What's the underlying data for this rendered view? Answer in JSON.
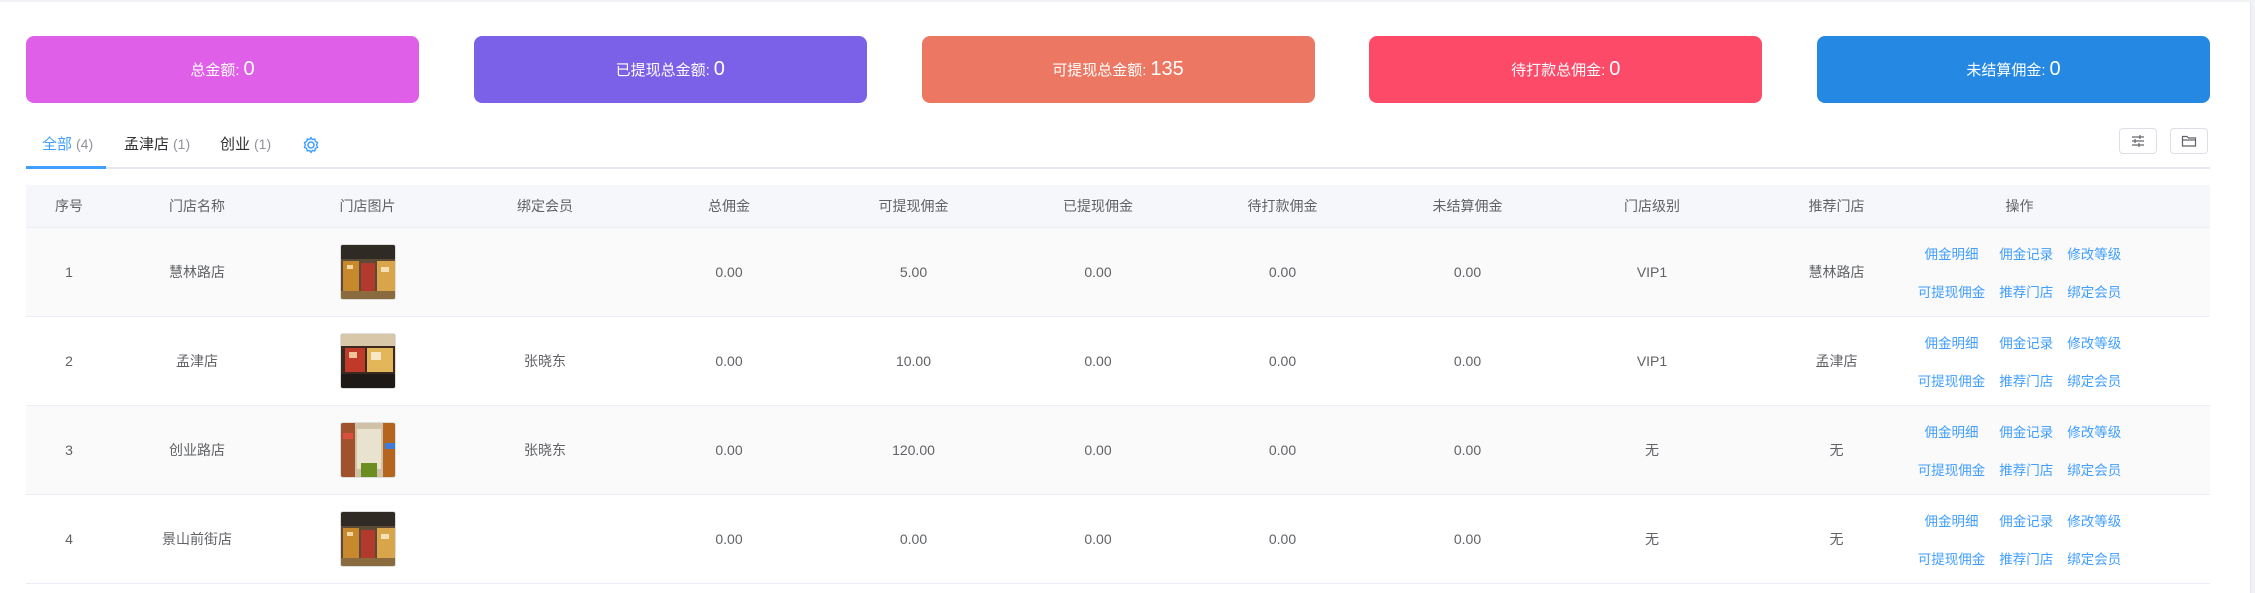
{
  "summary_cards": [
    {
      "label": "总金额:",
      "value": "0",
      "color": "#e05fe8"
    },
    {
      "label": "已提现总金额:",
      "value": "0",
      "color": "#7b61e8"
    },
    {
      "label": "可提现总金额:",
      "value": "135",
      "color": "#ec7762"
    },
    {
      "label": "待打款总佣金:",
      "value": "0",
      "color": "#fe4a69"
    },
    {
      "label": "未结算佣金:",
      "value": "0",
      "color": "#2589e3"
    }
  ],
  "tabs": [
    {
      "label": "全部",
      "count": "(4)"
    },
    {
      "label": "孟津店",
      "count": "(1)"
    },
    {
      "label": "创业",
      "count": "(1)"
    }
  ],
  "toolbar": {
    "gear_icon": "gear-icon",
    "filter_icon": "sliders-icon",
    "folder_icon": "folder-icon"
  },
  "table": {
    "headers": [
      "序号",
      "门店名称",
      "门店图片",
      "绑定会员",
      "总佣金",
      "可提现佣金",
      "已提现佣金",
      "待打款佣金",
      "未结算佣金",
      "门店级别",
      "推荐门店",
      "操作"
    ],
    "rows": [
      {
        "index": "1",
        "name": "慧林路店",
        "member": "",
        "total": "0.00",
        "withdrawable": "5.00",
        "withdrawn": "0.00",
        "pending": "0.00",
        "unsettled": "0.00",
        "level": "VIP1",
        "referrer": "慧林路店"
      },
      {
        "index": "2",
        "name": "孟津店",
        "member": "张晓东",
        "total": "0.00",
        "withdrawable": "10.00",
        "withdrawn": "0.00",
        "pending": "0.00",
        "unsettled": "0.00",
        "level": "VIP1",
        "referrer": "孟津店"
      },
      {
        "index": "3",
        "name": "创业路店",
        "member": "张晓东",
        "total": "0.00",
        "withdrawable": "120.00",
        "withdrawn": "0.00",
        "pending": "0.00",
        "unsettled": "0.00",
        "level": "无",
        "referrer": "无"
      },
      {
        "index": "4",
        "name": "景山前街店",
        "member": "",
        "total": "0.00",
        "withdrawable": "0.00",
        "withdrawn": "0.00",
        "pending": "0.00",
        "unsettled": "0.00",
        "level": "无",
        "referrer": "无"
      }
    ],
    "actions": [
      "佣金明细",
      "佣金记录",
      "修改等级",
      "可提现佣金",
      "推荐门店",
      "绑定会员"
    ]
  }
}
